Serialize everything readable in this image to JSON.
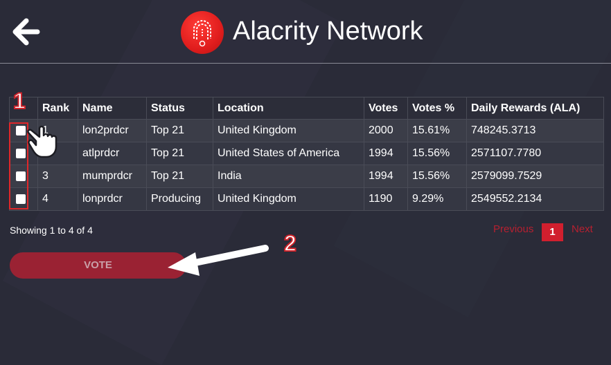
{
  "header": {
    "title": "Alacrity Network"
  },
  "table": {
    "headers": [
      "",
      "Rank",
      "Name",
      "Status",
      "Location",
      "Votes",
      "Votes %",
      "Daily Rewards (ALA)"
    ],
    "rows": [
      {
        "rank": "1",
        "name": "lon2prdcr",
        "status": "Top 21",
        "location": "United Kingdom",
        "votes": "2000",
        "votes_pct": "15.61%",
        "rewards": "748245.3713"
      },
      {
        "rank": "2",
        "name": "atlprdcr",
        "status": "Top 21",
        "location": "United States of America",
        "votes": "1994",
        "votes_pct": "15.56%",
        "rewards": "2571107.7780"
      },
      {
        "rank": "3",
        "name": "mumprdcr",
        "status": "Top 21",
        "location": "India",
        "votes": "1994",
        "votes_pct": "15.56%",
        "rewards": "2579099.7529"
      },
      {
        "rank": "4",
        "name": "lonprdcr",
        "status": "Producing",
        "location": "United Kingdom",
        "votes": "1190",
        "votes_pct": "9.29%",
        "rewards": "2549552.2134"
      }
    ]
  },
  "footer": {
    "showing": "Showing 1 to 4 of 4",
    "prev": "Previous",
    "page": "1",
    "next": "Next",
    "vote": "VOTE"
  },
  "annotations": {
    "step1": "1",
    "step2": "2"
  },
  "colors": {
    "accent": "#d11f2e",
    "background": "#2a2b38"
  }
}
